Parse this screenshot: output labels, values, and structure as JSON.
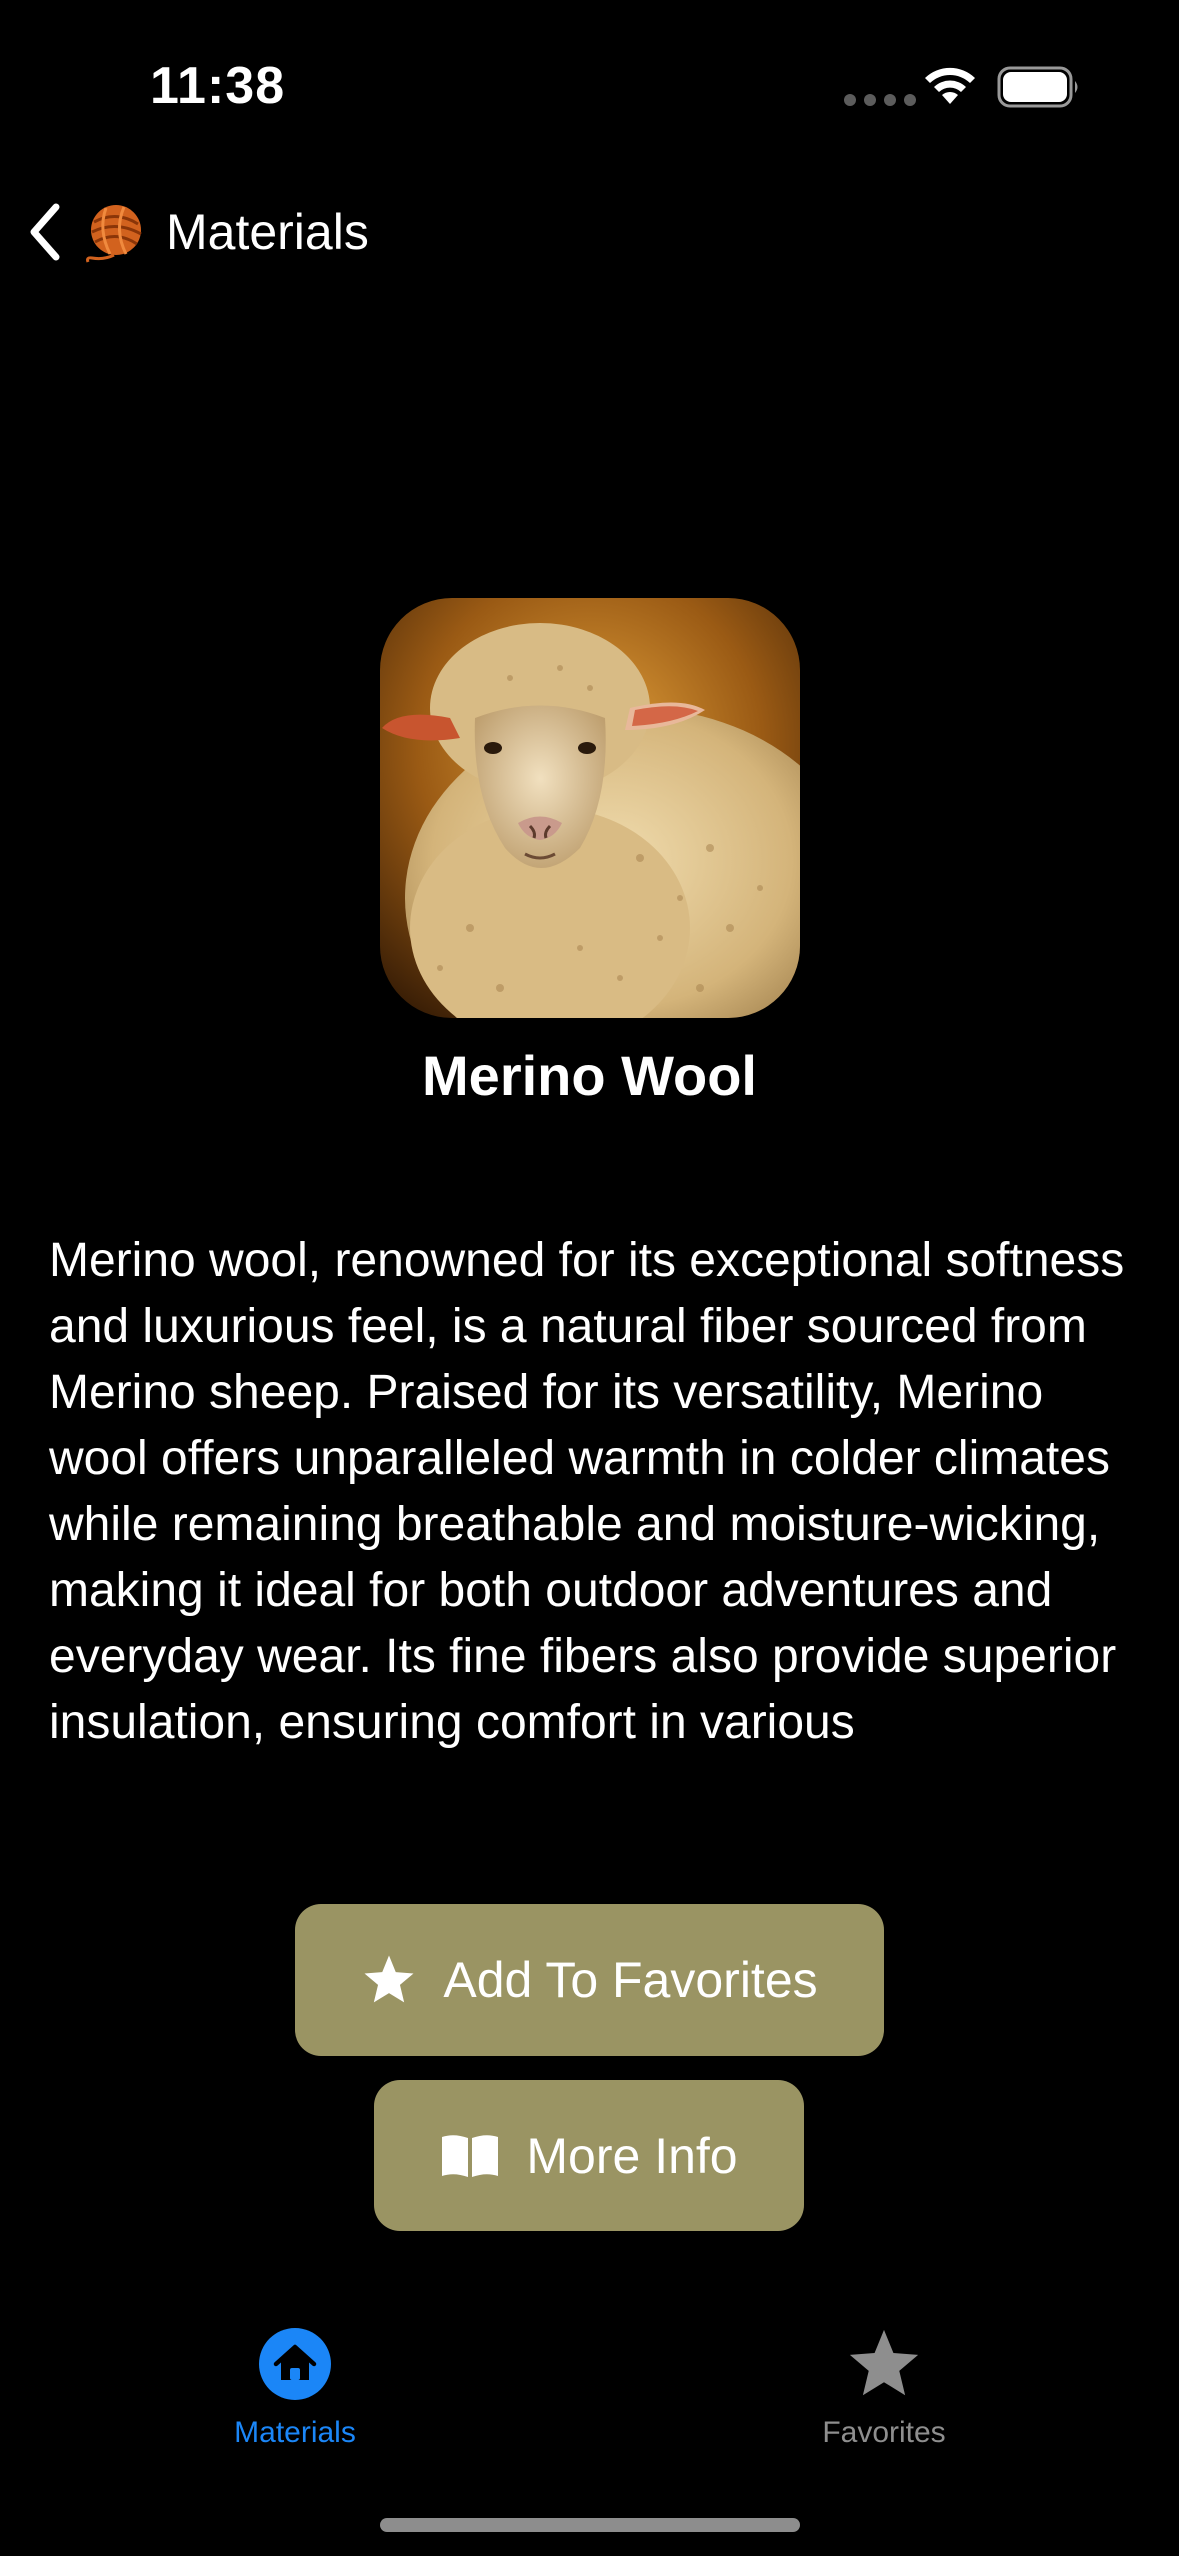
{
  "status_bar": {
    "time": "11:38"
  },
  "nav": {
    "back_label": "Materials",
    "back_icon": "chevron-left-icon",
    "yarn_icon": "yarn-ball-icon"
  },
  "material": {
    "name": "Merino Wool",
    "image_icon": "sheep-photo",
    "description": "Merino wool, renowned for its exceptional softness and luxurious feel, is a natural fiber sourced from Merino sheep. Praised for its versatility, Merino wool offers unparalleled warmth in colder climates while remaining breathable and moisture-wicking, making it ideal for both outdoor adventures and everyday wear. Its fine fibers also provide superior insulation, ensuring comfort in various"
  },
  "actions": {
    "favorites_label": "Add To Favorites",
    "favorites_icon": "star-icon",
    "more_info_label": "More Info",
    "more_info_icon": "book-icon",
    "button_color": "#9a9463"
  },
  "tab_bar": {
    "tabs": [
      {
        "label": "Materials",
        "icon": "home-icon",
        "selected": true,
        "color": "#1b86f7"
      },
      {
        "label": "Favorites",
        "icon": "star-icon",
        "selected": false,
        "color": "#8e8e8e"
      }
    ]
  }
}
